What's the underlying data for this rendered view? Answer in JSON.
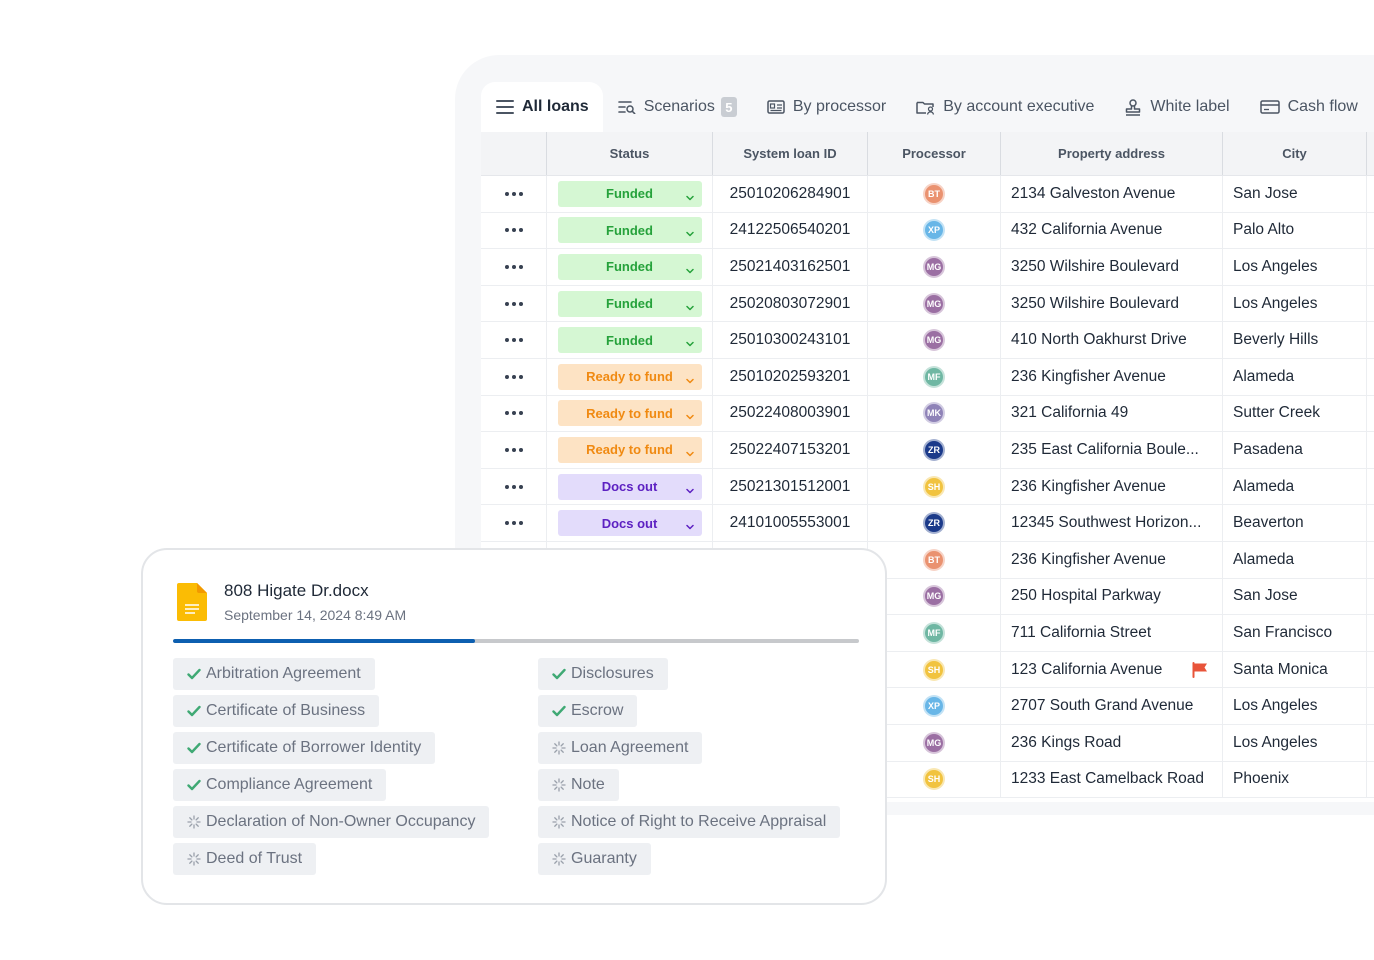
{
  "tabs": [
    {
      "label": "All loans",
      "icon": "list-icon",
      "active": true
    },
    {
      "label": "Scenarios",
      "icon": "scenario-icon",
      "badge": "5"
    },
    {
      "label": "By processor",
      "icon": "id-card-icon"
    },
    {
      "label": "By account executive",
      "icon": "folder-user-icon"
    },
    {
      "label": "White label",
      "icon": "stamp-icon"
    },
    {
      "label": "Cash flow",
      "icon": "cash-icon"
    }
  ],
  "columns": [
    "Status",
    "System loan ID",
    "Processor",
    "Property address",
    "City"
  ],
  "rows": [
    {
      "status": "Funded",
      "status_type": "funded",
      "id": "25010206284901",
      "proc": "BT",
      "proc_color": "#ea9270",
      "address": "2134 Galveston Avenue",
      "city": "San Jose"
    },
    {
      "status": "Funded",
      "status_type": "funded",
      "id": "24122506540201",
      "proc": "XP",
      "proc_color": "#68b6e7",
      "address": "432 California Avenue",
      "city": "Palo Alto"
    },
    {
      "status": "Funded",
      "status_type": "funded",
      "id": "25021403162501",
      "proc": "MG",
      "proc_color": "#9b6fa3",
      "address": "3250 Wilshire Boulevard",
      "city": "Los Angeles"
    },
    {
      "status": "Funded",
      "status_type": "funded",
      "id": "25020803072901",
      "proc": "MG",
      "proc_color": "#9b6fa3",
      "address": "3250 Wilshire Boulevard",
      "city": "Los Angeles"
    },
    {
      "status": "Funded",
      "status_type": "funded",
      "id": "25010300243101",
      "proc": "MG",
      "proc_color": "#9b6fa3",
      "address": "410 North Oakhurst Drive",
      "city": "Beverly Hills"
    },
    {
      "status": "Ready to fund",
      "status_type": "ready",
      "id": "25010202593201",
      "proc": "MF",
      "proc_color": "#6fb7a3",
      "address": "236 Kingfisher Avenue",
      "city": "Alameda"
    },
    {
      "status": "Ready to fund",
      "status_type": "ready",
      "id": "25022408003901",
      "proc": "MK",
      "proc_color": "#8f83b8",
      "address": "321 California 49",
      "city": "Sutter Creek"
    },
    {
      "status": "Ready to fund",
      "status_type": "ready",
      "id": "25022407153201",
      "proc": "ZR",
      "proc_color": "#1b3a8a",
      "address": "235 East California Boule...",
      "city": "Pasadena"
    },
    {
      "status": "Docs out",
      "status_type": "docs",
      "id": "25021301512001",
      "proc": "SH",
      "proc_color": "#f1c33f",
      "address": "236 Kingfisher Avenue",
      "city": "Alameda"
    },
    {
      "status": "Docs out",
      "status_type": "docs",
      "id": "24101005553001",
      "proc": "ZR",
      "proc_color": "#1b3a8a",
      "address": "12345 Southwest Horizon...",
      "city": "Beaverton"
    },
    {
      "status": "",
      "status_type": "docs",
      "id": "",
      "proc": "BT",
      "proc_color": "#ea9270",
      "address": "236 Kingfisher Avenue",
      "city": "Alameda"
    },
    {
      "status": "",
      "status_type": "docs",
      "id": "",
      "proc": "MG",
      "proc_color": "#9b6fa3",
      "address": "250 Hospital Parkway",
      "city": "San Jose"
    },
    {
      "status": "",
      "status_type": "docs",
      "id": "",
      "proc": "MF",
      "proc_color": "#6fb7a3",
      "address": "711 California Street",
      "city": "San Francisco"
    },
    {
      "status": "",
      "status_type": "docs",
      "id": "",
      "proc": "SH",
      "proc_color": "#f1c33f",
      "address": "123 California Avenue",
      "city": "Santa Monica",
      "flag": true
    },
    {
      "status": "",
      "status_type": "docs",
      "id": "",
      "proc": "XP",
      "proc_color": "#68b6e7",
      "address": "2707 South Grand Avenue",
      "city": "Los Angeles"
    },
    {
      "status": "",
      "status_type": "docs",
      "id": "",
      "proc": "MG",
      "proc_color": "#9b6fa3",
      "address": "236 Kings Road",
      "city": "Los Angeles"
    },
    {
      "status": "",
      "status_type": "docs",
      "id": "",
      "proc": "SH",
      "proc_color": "#f1c33f",
      "address": "1233 East Camelback Road",
      "city": "Phoenix"
    }
  ],
  "doc": {
    "title": "808 Higate Dr.docx",
    "date": "September 14, 2024 8:49 AM",
    "progress": 0.44,
    "left_items": [
      {
        "label": "Arbitration Agreement",
        "done": true
      },
      {
        "label": "Certificate of Business",
        "done": true
      },
      {
        "label": "Certificate of Borrower Identity",
        "done": true
      },
      {
        "label": "Compliance Agreement",
        "done": true
      },
      {
        "label": "Declaration of Non-Owner Occupancy",
        "done": false
      },
      {
        "label": "Deed of Trust",
        "done": false
      }
    ],
    "right_items": [
      {
        "label": "Disclosures",
        "done": true
      },
      {
        "label": "Escrow",
        "done": true
      },
      {
        "label": "Loan Agreement",
        "done": false
      },
      {
        "label": "Note",
        "done": false
      },
      {
        "label": "Notice of Right to Receive Appraisal",
        "done": false
      },
      {
        "label": "Guaranty",
        "done": false
      }
    ]
  },
  "colors": {
    "accent": "#0d5fb0",
    "check": "#3fa974",
    "doc_icon": "#fbbc04"
  }
}
